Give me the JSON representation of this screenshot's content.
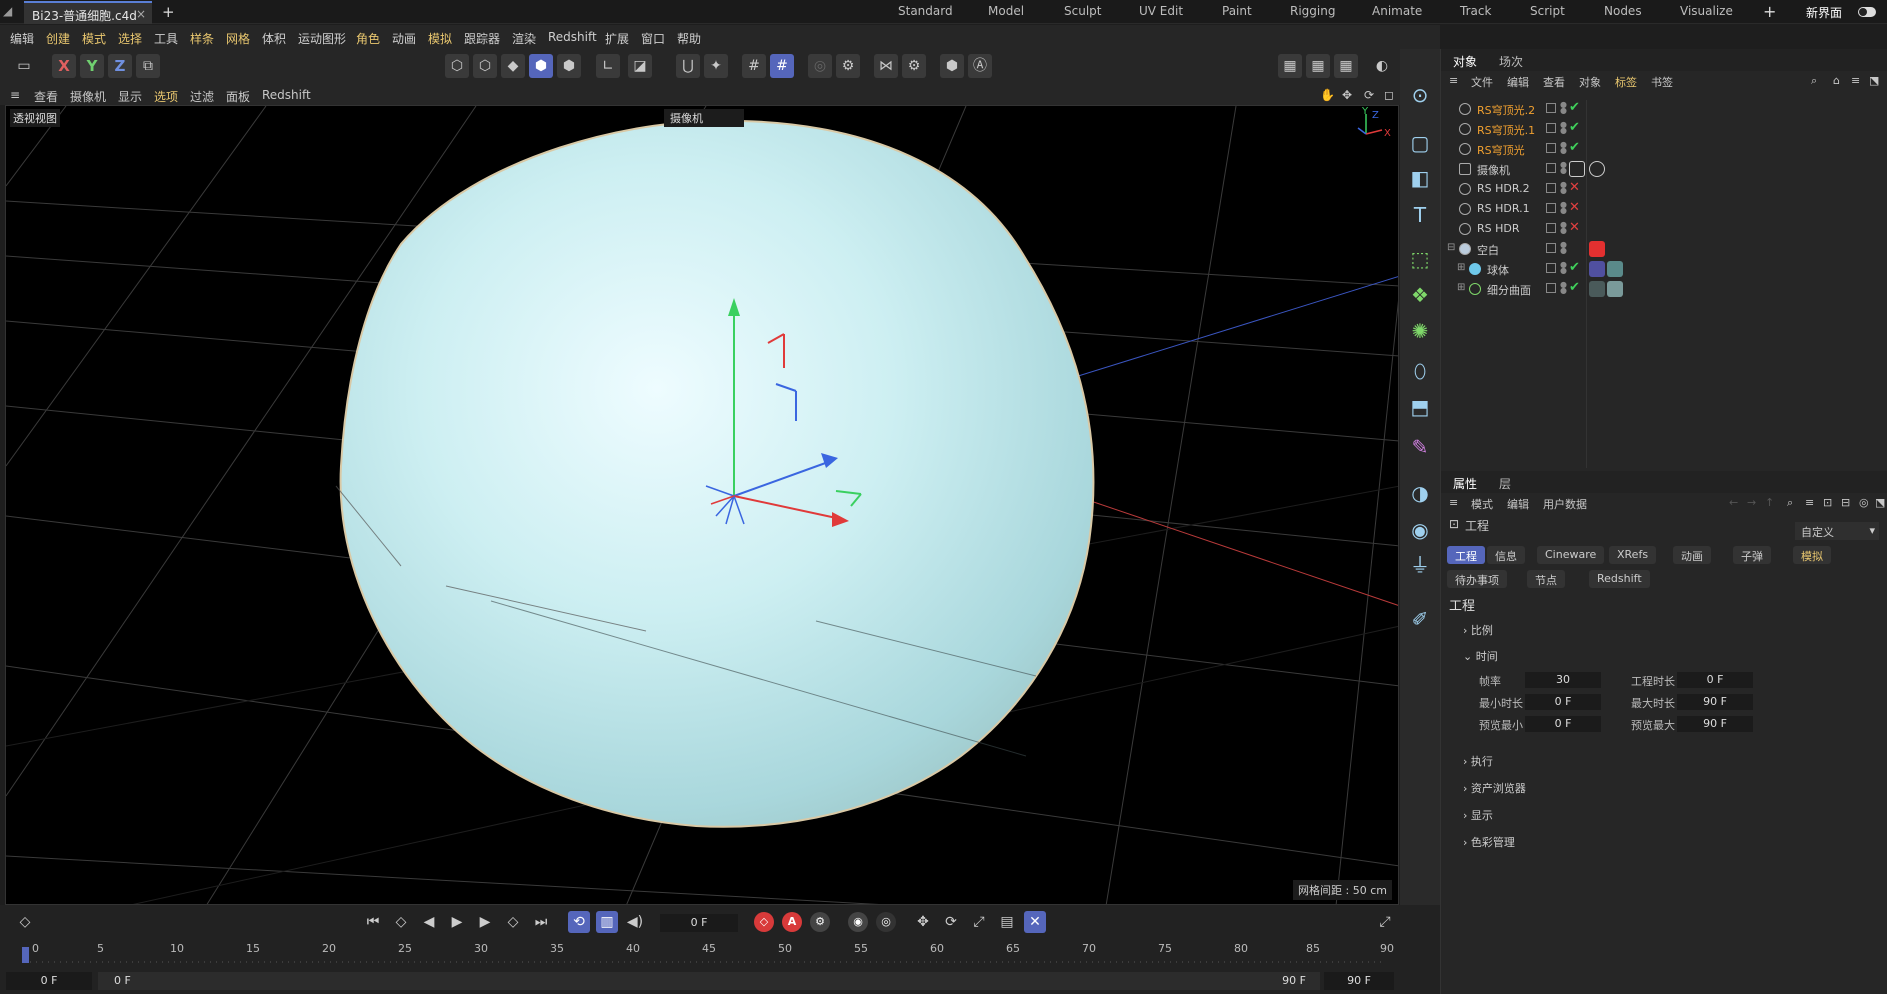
{
  "titlebar": {
    "file_tab": "Bi23-普通细胞.c4d",
    "close": "×",
    "add": "+",
    "layouts": [
      "Standard",
      "Model",
      "Sculpt",
      "UV Edit",
      "Paint",
      "Rigging",
      "Animate",
      "Track",
      "Script",
      "Nodes",
      "Visualize"
    ],
    "new_ui_label": "新界面"
  },
  "menubar": [
    "编辑",
    "创建",
    "模式",
    "选择",
    "工具",
    "样条",
    "网格",
    "体积",
    "运动图形",
    "角色",
    "动画",
    "模拟",
    "跟踪器",
    "渲染",
    "Redshift",
    "扩展",
    "窗口",
    "帮助"
  ],
  "toolbar": {
    "axis_x": "X",
    "axis_y": "Y",
    "axis_z": "Z"
  },
  "viewport_menu": [
    "查看",
    "摄像机",
    "显示",
    "选项",
    "过滤",
    "面板",
    "Redshift"
  ],
  "viewport": {
    "label": "透视视图",
    "camera": "摄像机",
    "grid_spacing": "网格间距 : 50 cm"
  },
  "objects_panel": {
    "tabs": [
      "对象",
      "场次"
    ],
    "menu": [
      "文件",
      "编辑",
      "查看",
      "对象",
      "标签",
      "书签"
    ],
    "rows": [
      {
        "name": "RS穹顶光.2",
        "highlight": true,
        "state": "✔"
      },
      {
        "name": "RS穹顶光.1",
        "highlight": true,
        "state": "✔"
      },
      {
        "name": "RS穹顶光",
        "highlight": true,
        "state": "✔"
      },
      {
        "name": "摄像机",
        "highlight": false,
        "state": ""
      },
      {
        "name": "RS HDR.2",
        "highlight": false,
        "state": "✕"
      },
      {
        "name": "RS HDR.1",
        "highlight": false,
        "state": "✕"
      },
      {
        "name": "RS HDR",
        "highlight": false,
        "state": "✕"
      },
      {
        "name": "空白",
        "highlight": false,
        "state": ""
      },
      {
        "name": "球体",
        "highlight": false,
        "state": "✔"
      },
      {
        "name": "细分曲面",
        "highlight": false,
        "state": "✔"
      }
    ]
  },
  "attributes_panel": {
    "tabs": [
      "属性",
      "层"
    ],
    "menu": [
      "模式",
      "编辑",
      "用户数据"
    ],
    "title": "工程",
    "dropdown": "自定义",
    "tab_buttons_row1": [
      "工程",
      "信息",
      "Cineware",
      "XRefs",
      "动画",
      "子弹",
      "模拟"
    ],
    "tab_buttons_row2": [
      "待办事项",
      "节点",
      "Redshift"
    ],
    "section_title": "工程",
    "sections": [
      "比例",
      "时间",
      "执行",
      "资产浏览器",
      "显示",
      "色彩管理"
    ],
    "time_fields": [
      {
        "label": "帧率",
        "value": "30"
      },
      {
        "label": "工程时长",
        "value": "0 F"
      },
      {
        "label": "最小时长",
        "value": "0 F"
      },
      {
        "label": "最大时长",
        "value": "90 F"
      },
      {
        "label": "预览最小",
        "value": "0 F"
      },
      {
        "label": "预览最大",
        "value": "90 F"
      }
    ]
  },
  "timeline": {
    "current_frame": "0 F",
    "ticks": [
      "0",
      "5",
      "10",
      "15",
      "20",
      "25",
      "30",
      "35",
      "40",
      "45",
      "50",
      "55",
      "60",
      "65",
      "70",
      "75",
      "80",
      "85",
      "90"
    ],
    "range_start": "0 F",
    "range_start2": "0 F",
    "range_end": "90 F",
    "range_end2": "90 F"
  }
}
